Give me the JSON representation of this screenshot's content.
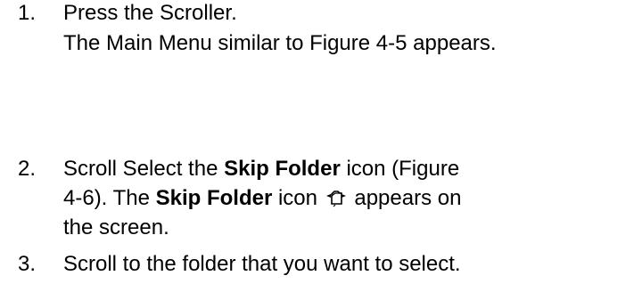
{
  "steps": [
    {
      "number": "1.",
      "lines": [
        "Press the Scroller.",
        "The Main Menu similar to Figure 4-5 appears."
      ]
    },
    {
      "number": "2.",
      "line1_pre": "Scroll Select the ",
      "line1_bold": "Skip Folder",
      "line1_post": " icon (Figure",
      "line2_pre": "4-6). The ",
      "line2_bold": "Skip Folder",
      "line2_mid": " icon ",
      "line2_icon": "skip-folder-icon",
      "line2_post": " appears on",
      "line3": "the screen."
    },
    {
      "number": "3.",
      "lines": [
        "Scroll to the folder that you want to select."
      ]
    }
  ]
}
